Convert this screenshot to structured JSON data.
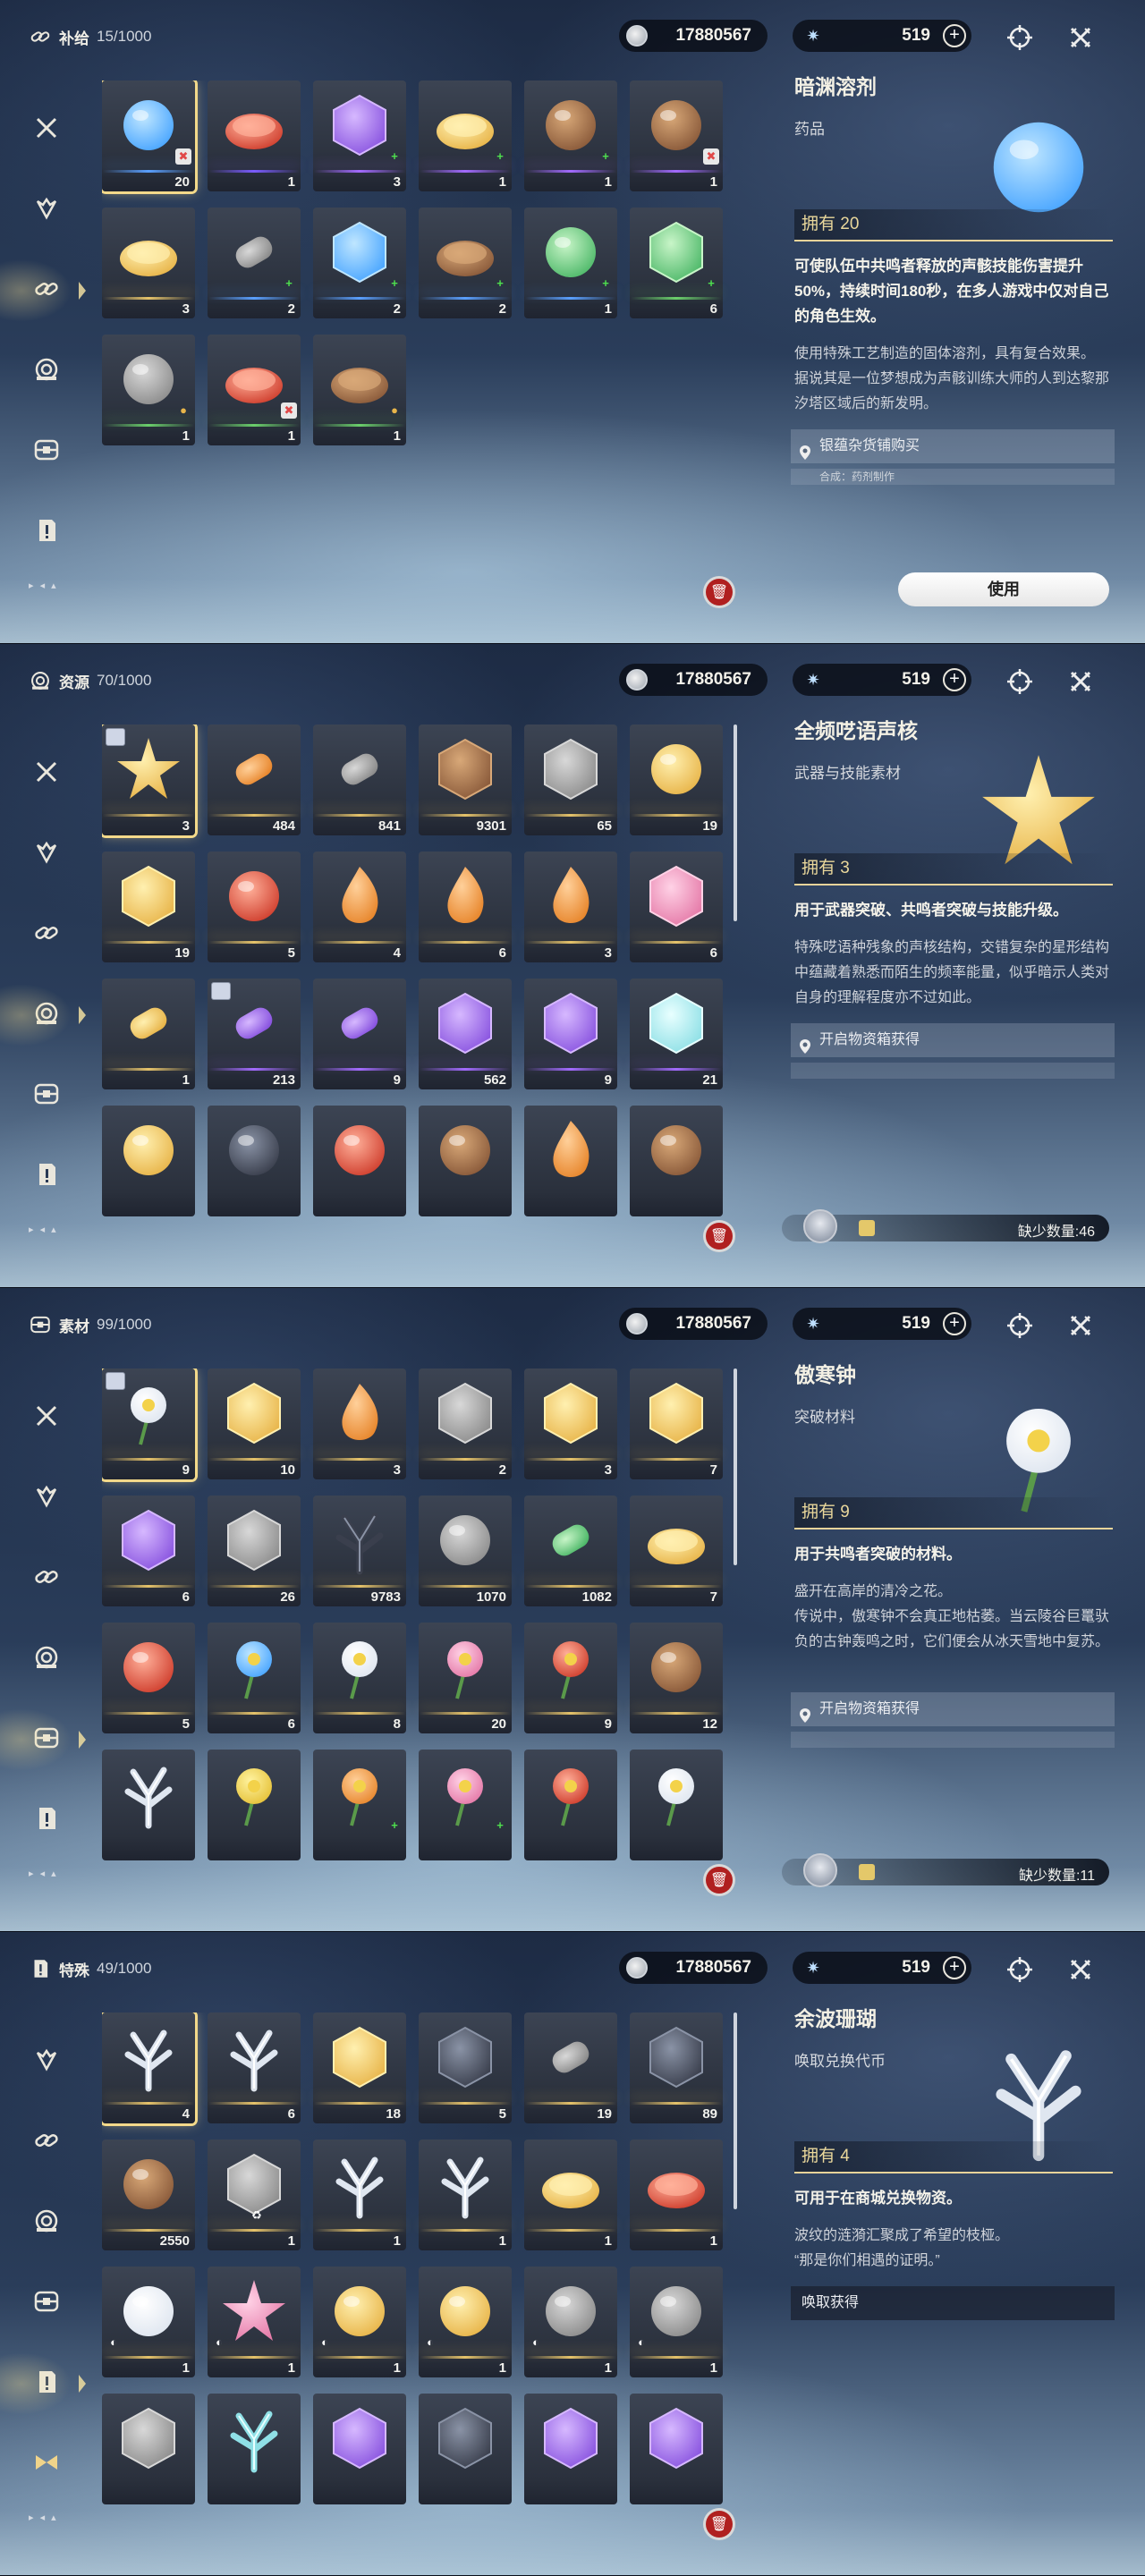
{
  "header": {
    "currency_value": "17880567",
    "stamina_value": "519"
  },
  "panels": [
    {
      "category": "补给",
      "count": "15/1000",
      "active_nav": 2,
      "items": [
        {
          "icon": "blue-liquid-sphere",
          "qty": "20",
          "rarity": "#5aa0ff",
          "tag": "x",
          "selected": true
        },
        {
          "icon": "roast-chicken",
          "qty": "1",
          "rarity": "#7b5cff",
          "tag": ""
        },
        {
          "icon": "purple-pill-pack",
          "qty": "3",
          "rarity": "#a36bff",
          "tag": "plus"
        },
        {
          "icon": "bento-box",
          "qty": "1",
          "rarity": "#a36bff",
          "tag": "plus"
        },
        {
          "icon": "jar",
          "qty": "1",
          "rarity": "#a36bff",
          "tag": "plus"
        },
        {
          "icon": "drink-glass",
          "qty": "1",
          "rarity": "#a36bff",
          "tag": "x"
        },
        {
          "icon": "pastry",
          "qty": "3",
          "rarity": "#e6c36a",
          "tag": ""
        },
        {
          "icon": "spray-bottle",
          "qty": "2",
          "rarity": "#5aa0ff",
          "tag": "plus"
        },
        {
          "icon": "blue-pill-pack",
          "qty": "2",
          "rarity": "#5aa0ff",
          "tag": "plus"
        },
        {
          "icon": "dumplings",
          "qty": "2",
          "rarity": "#5aa0ff",
          "tag": "plus"
        },
        {
          "icon": "green-pouch",
          "qty": "1",
          "rarity": "#5aa0ff",
          "tag": "plus"
        },
        {
          "icon": "green-pill-pack",
          "qty": "6",
          "rarity": "#6bd06b",
          "tag": "plus"
        },
        {
          "icon": "tool-kit",
          "qty": "1",
          "rarity": "#6bd06b",
          "tag": "gold"
        },
        {
          "icon": "skewers",
          "qty": "1",
          "rarity": "#6bd06b",
          "tag": "x"
        },
        {
          "icon": "soup-bowl",
          "qty": "1",
          "rarity": "#6bd06b",
          "tag": "gold"
        }
      ],
      "detail": {
        "name": "暗渊溶剂",
        "type": "药品",
        "type_mark": "x",
        "own": "拥有 20",
        "effect": "可使队伍中共鸣者释放的声骸技能伤害提升50%，持续时间180秒，在多人游戏中仅对自己的角色生效。",
        "desc": [
          "使用特殊工艺制造的固体溶剂，具有复合效果。",
          "据说其是一位梦想成为声骸训练大师的人到达黎那汐塔区域后的新发明。"
        ],
        "source": "银蕴杂货铺购买",
        "source2": "合成：药剂制作",
        "button": "使用",
        "shortage": ""
      }
    },
    {
      "category": "资源",
      "count": "70/1000",
      "active_nav": 3,
      "items": [
        {
          "icon": "gold-star-core",
          "qty": "3",
          "rarity": "#e6c36a",
          "selected": true,
          "badge": true
        },
        {
          "icon": "orange-vial",
          "qty": "484",
          "rarity": "#e6c36a"
        },
        {
          "icon": "cartridge",
          "qty": "841",
          "rarity": "#e6c36a"
        },
        {
          "icon": "brown-crystal",
          "qty": "9301",
          "rarity": "#e6c36a"
        },
        {
          "icon": "metal-plate",
          "qty": "65",
          "rarity": "#e6c36a"
        },
        {
          "icon": "gold-orb",
          "qty": "19",
          "rarity": "#e6c36a"
        },
        {
          "icon": "gold-hexagon",
          "qty": "19",
          "rarity": "#e6c36a"
        },
        {
          "icon": "red-mech",
          "qty": "5",
          "rarity": "#e6c36a"
        },
        {
          "icon": "flame-spire",
          "qty": "4",
          "rarity": "#e6c36a"
        },
        {
          "icon": "fire-seed",
          "qty": "6",
          "rarity": "#e6c36a"
        },
        {
          "icon": "gold-flame",
          "qty": "3",
          "rarity": "#e6c36a"
        },
        {
          "icon": "pink-cubes",
          "qty": "6",
          "rarity": "#e6c36a"
        },
        {
          "icon": "scroll",
          "qty": "1",
          "rarity": "#e6c36a"
        },
        {
          "icon": "purple-vial",
          "qty": "213",
          "rarity": "#a36bff",
          "badge": true
        },
        {
          "icon": "purple-cartridge",
          "qty": "9",
          "rarity": "#a36bff"
        },
        {
          "icon": "purple-crystal",
          "qty": "562",
          "rarity": "#a36bff"
        },
        {
          "icon": "purple-hexagon",
          "qty": "9",
          "rarity": "#a36bff"
        },
        {
          "icon": "ice-crystal",
          "qty": "21",
          "rarity": "#a36bff"
        },
        {
          "icon": "gold-pyramid",
          "qty": "",
          "rarity": ""
        },
        {
          "icon": "dark-crown",
          "qty": "",
          "rarity": ""
        },
        {
          "icon": "red-robot",
          "qty": "",
          "rarity": ""
        },
        {
          "icon": "shell",
          "qty": "",
          "rarity": ""
        },
        {
          "icon": "ember",
          "qty": "",
          "rarity": ""
        },
        {
          "icon": "spiral-shell",
          "qty": "",
          "rarity": ""
        }
      ],
      "detail": {
        "name": "全频呓语声核",
        "type": "武器与技能素材",
        "own": "拥有 3",
        "effect": "用于武器突破、共鸣者突破与技能升级。",
        "desc": [
          "特殊呓语种残象的声核结构，交错复杂的星形结构中蕴藏着熟悉而陌生的频率能量，似乎暗示人类对自身的理解程度亦不过如此。"
        ],
        "source": "开启物资箱获得",
        "source2": "",
        "button": "",
        "shortage": "缺少数量:46"
      }
    },
    {
      "category": "素材",
      "count": "99/1000",
      "active_nav": 4,
      "items": [
        {
          "icon": "white-flower",
          "qty": "9",
          "rarity": "#e6c36a",
          "selected": true,
          "badge": true
        },
        {
          "icon": "gold-cube",
          "qty": "10",
          "rarity": "#e6c36a"
        },
        {
          "icon": "flame-burst",
          "qty": "3",
          "rarity": "#e6c36a"
        },
        {
          "icon": "book",
          "qty": "2",
          "rarity": "#e6c36a"
        },
        {
          "icon": "gold-cube-2",
          "qty": "3",
          "rarity": "#e6c36a"
        },
        {
          "icon": "gold-cube-3",
          "qty": "7",
          "rarity": "#e6c36a"
        },
        {
          "icon": "purple-card",
          "qty": "6",
          "rarity": "#e6c36a"
        },
        {
          "icon": "stone-cube",
          "qty": "26",
          "rarity": "#e6c36a"
        },
        {
          "icon": "dark-shard",
          "qty": "9783",
          "rarity": "#e6c36a"
        },
        {
          "icon": "stone-ball",
          "qty": "1070",
          "rarity": "#e6c36a"
        },
        {
          "icon": "green-capsule",
          "qty": "1082",
          "rarity": "#e6c36a"
        },
        {
          "icon": "eggs",
          "qty": "7",
          "rarity": "#e6c36a"
        },
        {
          "icon": "red-fruit",
          "qty": "5",
          "rarity": "#e6c36a"
        },
        {
          "icon": "blue-flower",
          "qty": "6",
          "rarity": "#e6c36a"
        },
        {
          "icon": "white-sprout",
          "qty": "8",
          "rarity": "#e6c36a"
        },
        {
          "icon": "pink-lily",
          "qty": "20",
          "rarity": "#e6c36a"
        },
        {
          "icon": "red-poppy",
          "qty": "9",
          "rarity": "#e6c36a"
        },
        {
          "icon": "mushroom",
          "qty": "12",
          "rarity": "#e6c36a"
        },
        {
          "icon": "coral-plant",
          "qty": "",
          "rarity": ""
        },
        {
          "icon": "yellow-bud",
          "qty": "",
          "rarity": ""
        },
        {
          "icon": "orange-herb",
          "qty": "",
          "rarity": "",
          "tag": "plus"
        },
        {
          "icon": "pink-herb",
          "qty": "",
          "rarity": "",
          "tag": "plus"
        },
        {
          "icon": "red-herb",
          "qty": "",
          "rarity": ""
        },
        {
          "icon": "white-blossom",
          "qty": "",
          "rarity": ""
        }
      ],
      "detail": {
        "name": "傲寒钟",
        "type": "突破材料",
        "own": "拥有 9",
        "effect": "用于共鸣者突破的材料。",
        "desc": [
          "盛开在高岸的清冷之花。",
          "传说中，傲寒钟不会真正地枯萎。当云陵谷巨鼍驮负的古钟轰鸣之时，它们便会从冰天雪地中复苏。"
        ],
        "source": "开启物资箱获得",
        "source2": "",
        "button": "",
        "shortage": "缺少数量:11"
      }
    },
    {
      "category": "特殊",
      "count": "49/1000",
      "active_nav": 5,
      "items": [
        {
          "icon": "coral-branch",
          "qty": "4",
          "rarity": "#e6c36a",
          "selected": true
        },
        {
          "icon": "coral-branch-2",
          "qty": "6",
          "rarity": "#e6c36a"
        },
        {
          "icon": "gold-chest",
          "qty": "18",
          "rarity": "#e6c36a"
        },
        {
          "icon": "silver-chest",
          "qty": "5",
          "rarity": "#e6c36a"
        },
        {
          "icon": "capsule",
          "qty": "19",
          "rarity": "#e6c36a"
        },
        {
          "icon": "dark-chest",
          "qty": "89",
          "rarity": "#e6c36a"
        },
        {
          "icon": "ink-jar",
          "qty": "2550",
          "rarity": "#e6c36a"
        },
        {
          "icon": "badge-card",
          "qty": "1",
          "rarity": "#e6c36a",
          "tag": "recycle"
        },
        {
          "icon": "feather-blade",
          "qty": "1",
          "rarity": "#e6c36a"
        },
        {
          "icon": "paper-crane",
          "qty": "1",
          "rarity": "#e6c36a"
        },
        {
          "icon": "cake",
          "qty": "1",
          "rarity": "#e6c36a"
        },
        {
          "icon": "tiered-cake",
          "qty": "1",
          "rarity": "#e6c36a"
        },
        {
          "icon": "snow-seal",
          "qty": "1",
          "rarity": "#e6c36a",
          "tag": "dark"
        },
        {
          "icon": "star-bouquet",
          "qty": "1",
          "rarity": "#e6c36a",
          "tag": "dark"
        },
        {
          "icon": "gold-crown",
          "qty": "1",
          "rarity": "#e6c36a",
          "tag": "dark"
        },
        {
          "icon": "gold-tiara",
          "qty": "1",
          "rarity": "#e6c36a",
          "tag": "dark"
        },
        {
          "icon": "mask",
          "qty": "1",
          "rarity": "#e6c36a",
          "tag": "dark"
        },
        {
          "icon": "perfume",
          "qty": "1",
          "rarity": "#e6c36a",
          "tag": "dark"
        },
        {
          "icon": "card-pack",
          "qty": "",
          "rarity": ""
        },
        {
          "icon": "blue-coral",
          "qty": "",
          "rarity": ""
        },
        {
          "icon": "purple-chest",
          "qty": "",
          "rarity": ""
        },
        {
          "icon": "black-chest",
          "qty": "",
          "rarity": ""
        },
        {
          "icon": "purple-chest-2",
          "qty": "",
          "rarity": ""
        },
        {
          "icon": "purple-chest-3",
          "qty": "",
          "rarity": ""
        }
      ],
      "detail": {
        "name": "余波珊瑚",
        "type": "唤取兑换代币",
        "own": "拥有 4",
        "effect": "可用于在商城兑换物资。",
        "desc": [
          "波纹的涟漪汇聚成了希望的枝桠。",
          "“那是你们相遇的证明。”"
        ],
        "source": "",
        "source2": "",
        "source_plain": "唤取获得",
        "button": "",
        "shortage": ""
      }
    }
  ],
  "nav_icons": [
    "crossed-swords-icon",
    "demon-mask-icon",
    "link-icon",
    "resource-target-icon",
    "material-chest-icon",
    "quest-doc-icon",
    "special-bow-icon"
  ],
  "colors": {
    "gold": "#e8d49a",
    "select": "#f3d98a",
    "trash": "#b02020"
  }
}
